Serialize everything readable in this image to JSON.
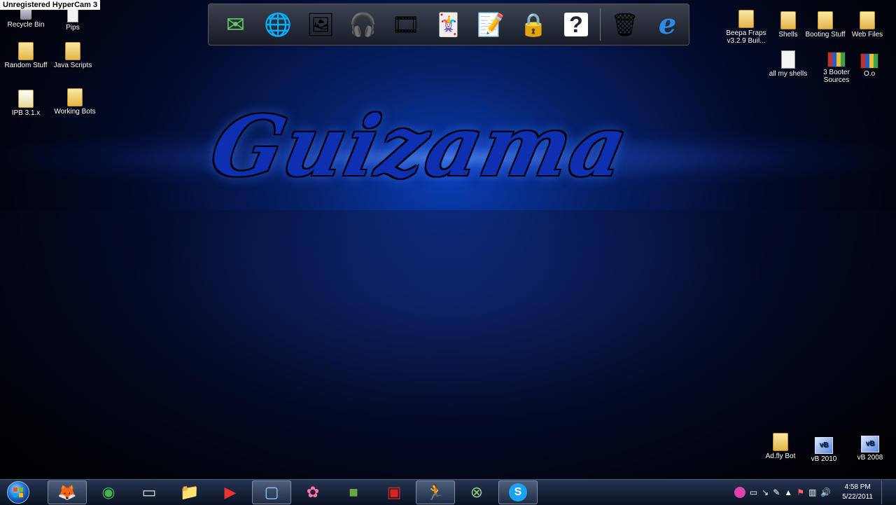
{
  "recorder_watermark": "Unregistered HyperCam 3",
  "wallpaper_title": "Guizama",
  "desktop_icons_left": [
    {
      "label": "Recycle Bin",
      "icon": "recycle-bin-icon"
    },
    {
      "label": "Pips",
      "icon": "file-icon"
    },
    {
      "label": "Random Stuff",
      "icon": "folder-icon"
    },
    {
      "label": "Java Scripts",
      "icon": "folder-icon"
    },
    {
      "label": "IPB 3.1.x",
      "icon": "folder-icon"
    },
    {
      "label": "Working Bots",
      "icon": "folder-icon"
    }
  ],
  "desktop_icons_right": [
    {
      "label": "Beepa Fraps v3.2.9 Buil...",
      "icon": "folder-icon"
    },
    {
      "label": "Shells",
      "icon": "folder-icon"
    },
    {
      "label": "Booting Stuff",
      "icon": "folder-icon"
    },
    {
      "label": "Web Files",
      "icon": "folder-icon"
    },
    {
      "label": "all my shells",
      "icon": "text-file-icon"
    },
    {
      "label": "3 Booter Sources",
      "icon": "winrar-icon"
    },
    {
      "label": "O.o",
      "icon": "winrar-icon"
    }
  ],
  "desktop_icons_bottom": [
    {
      "label": "Ad.fly Bot",
      "icon": "folder-icon"
    },
    {
      "label": "vB 2010",
      "icon": "vbulletin-icon"
    },
    {
      "label": "vB 2008",
      "icon": "vbulletin-icon"
    }
  ],
  "dock_items": [
    {
      "icon": "mail-icon",
      "glyph": "✉"
    },
    {
      "icon": "globe-icon",
      "glyph": "🌐"
    },
    {
      "icon": "photos-icon",
      "glyph": "🖼"
    },
    {
      "icon": "headphones-icon",
      "glyph": "🎧"
    },
    {
      "icon": "film-reel-icon",
      "glyph": "🎞"
    },
    {
      "icon": "cards-icon",
      "glyph": "🃏"
    },
    {
      "icon": "notepad-icon",
      "glyph": "📝"
    },
    {
      "icon": "lock-icon",
      "glyph": "🔒"
    },
    {
      "icon": "help-icon",
      "glyph": "?"
    },
    {
      "icon": "trash-icon",
      "glyph": "🗑"
    },
    {
      "icon": "internet-explorer-icon",
      "glyph": "e"
    }
  ],
  "taskbar": {
    "pinned": [
      {
        "icon": "firefox-icon",
        "glyph": "🦊"
      },
      {
        "icon": "chrome-icon",
        "glyph": "◉"
      },
      {
        "icon": "command-prompt-icon",
        "glyph": "▭"
      },
      {
        "icon": "folder-icon",
        "glyph": "📁"
      },
      {
        "icon": "media-player-icon",
        "glyph": "▶"
      },
      {
        "icon": "window-icon",
        "glyph": "▢"
      },
      {
        "icon": "pinwheel-icon",
        "glyph": "✿"
      },
      {
        "icon": "minecraft-icon",
        "glyph": "■"
      },
      {
        "icon": "fraps-icon",
        "glyph": "▣"
      },
      {
        "icon": "aim-icon",
        "glyph": "🏃"
      },
      {
        "icon": "xbox-icon",
        "glyph": "⊗"
      },
      {
        "icon": "skype-icon",
        "glyph": "S"
      }
    ],
    "clock_time": "4:58 PM",
    "clock_date": "5/22/2011"
  },
  "colors": {
    "accent_blue": "#0d2fb0",
    "taskbar": "#1a2a48"
  }
}
